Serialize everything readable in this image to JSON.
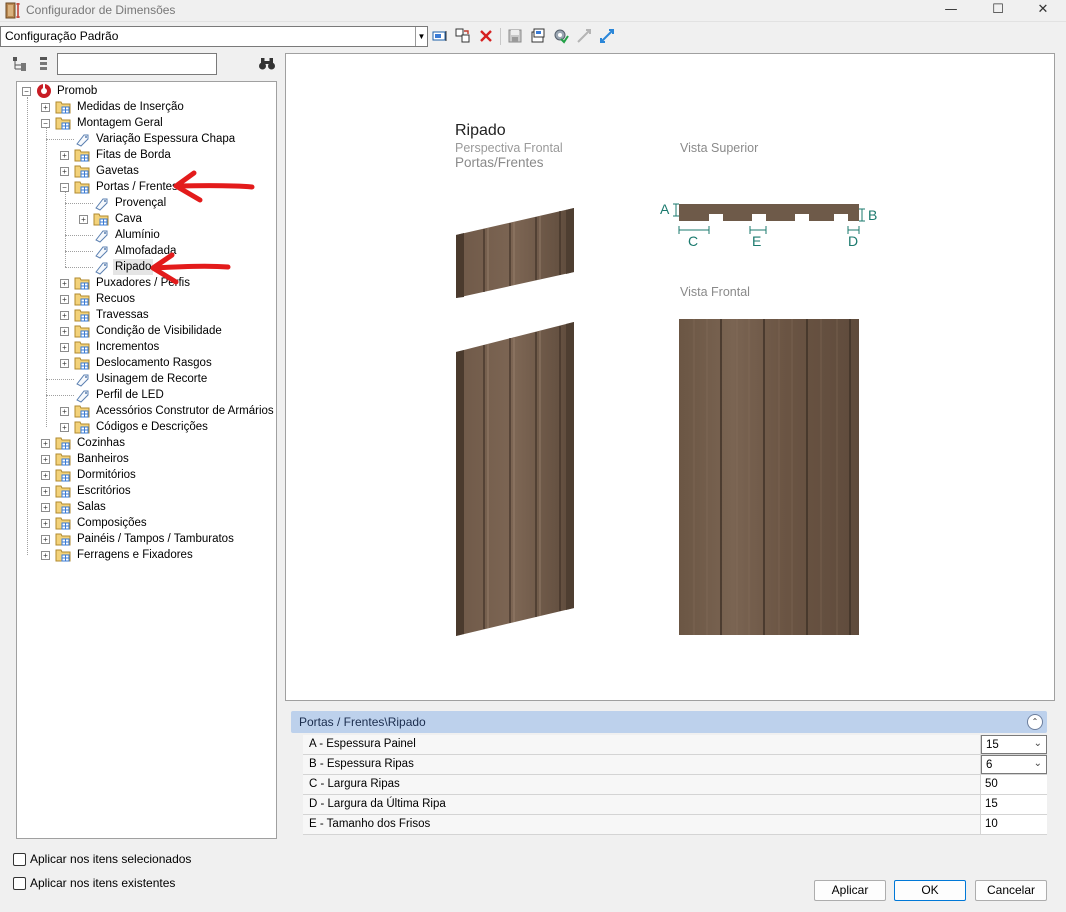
{
  "window": {
    "title": "Configurador de Dimensões",
    "controls": {
      "minimize": "—",
      "maximize": "☐",
      "close": "✕"
    }
  },
  "config": {
    "selected": "Configuração Padrão",
    "toolbar": [
      "edit-config-icon",
      "copy-config-icon",
      "delete-config-icon",
      "save-icon",
      "import-icon",
      "check-icon",
      "collapse-arrows-icon",
      "expand-arrows-icon"
    ]
  },
  "search": {
    "value": "",
    "placeholder": ""
  },
  "tree": {
    "root": "Promob",
    "items": {
      "medidas": "Medidas de Inserção",
      "montagem": "Montagem Geral",
      "variacao": "Variação Espessura Chapa",
      "fitas": "Fitas de Borda",
      "gavetas": "Gavetas",
      "portas": "Portas / Frentes",
      "provencal": "Provençal",
      "cava": "Cava",
      "aluminio": "Alumínio",
      "almofadada": "Almofadada",
      "ripado": "Ripado",
      "puxadores": "Puxadores / Perfis",
      "recuos": "Recuos",
      "travessas": "Travessas",
      "condicao": "Condição de Visibilidade",
      "incrementos": "Incrementos",
      "deslocamento": "Deslocamento Rasgos",
      "usinagem": "Usinagem de Recorte",
      "perfil_led": "Perfil de LED",
      "acessorios": "Acessórios Construtor de Armários",
      "codigos": "Códigos e Descrições",
      "cozinhas": "Cozinhas",
      "banheiros": "Banheiros",
      "dormitorios": "Dormitórios",
      "escritorios": "Escritórios",
      "salas": "Salas",
      "composicoes": "Composições",
      "paineis": "Painéis / Tampos / Tamburatos",
      "ferragens": "Ferragens e Fixadores"
    }
  },
  "preview": {
    "title": "Ripado",
    "subtitle": "Perspectiva Frontal",
    "category": "Portas/Frentes",
    "top_view_label": "Vista Superior",
    "front_view_label": "Vista Frontal",
    "dims": {
      "a": "A",
      "b": "B",
      "c": "C",
      "d": "D",
      "e": "E"
    },
    "wood_color": "#6b5644",
    "dim_color": "#1b7a6e"
  },
  "properties": {
    "path": "Portas / Frentes\\Ripado",
    "rows": [
      {
        "name": "A - Espessura Painel",
        "value": "15"
      },
      {
        "name": "B - Espessura Ripas",
        "value": "6"
      },
      {
        "name": "C - Largura Ripas",
        "value": "50"
      },
      {
        "name": "D - Largura da Última Ripa",
        "value": "15"
      },
      {
        "name": "E - Tamanho dos Frisos",
        "value": "10"
      }
    ]
  },
  "options": {
    "apply_selected": {
      "label": "Aplicar nos itens selecionados",
      "checked": false
    },
    "apply_existing": {
      "label": "Aplicar nos itens existentes",
      "checked": false
    }
  },
  "buttons": {
    "apply": "Aplicar",
    "ok": "OK",
    "cancel": "Cancelar"
  }
}
